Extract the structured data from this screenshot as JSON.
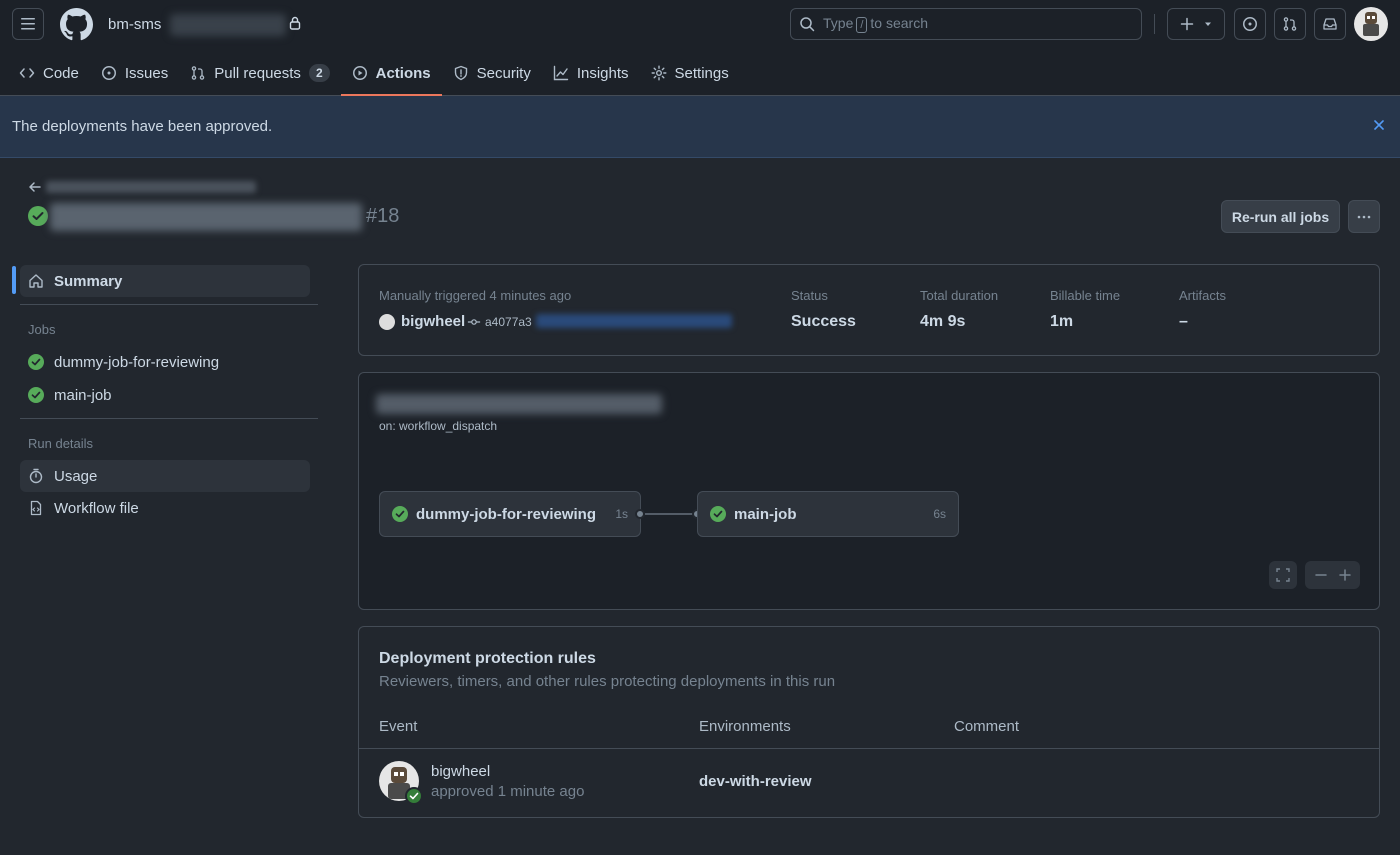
{
  "header": {
    "owner": "bm-sms",
    "search_text_before": "Type",
    "search_key": "/",
    "search_text_after": "to search"
  },
  "nav": {
    "tabs": [
      {
        "label": "Code",
        "icon": "code-icon"
      },
      {
        "label": "Issues",
        "icon": "issue-opened-icon"
      },
      {
        "label": "Pull requests",
        "icon": "git-pull-request-icon",
        "count": "2"
      },
      {
        "label": "Actions",
        "icon": "play-icon",
        "active": true
      },
      {
        "label": "Security",
        "icon": "shield-icon"
      },
      {
        "label": "Insights",
        "icon": "graph-icon"
      },
      {
        "label": "Settings",
        "icon": "gear-icon"
      }
    ]
  },
  "flash": {
    "message": "The deployments have been approved."
  },
  "run": {
    "number": "#18",
    "rerun_label": "Re-run all jobs"
  },
  "sidebar": {
    "summary": "Summary",
    "jobs_heading": "Jobs",
    "jobs": [
      "dummy-job-for-reviewing",
      "main-job"
    ],
    "details_heading": "Run details",
    "usage": "Usage",
    "workflow_file": "Workflow file"
  },
  "summary": {
    "trigger": "Manually triggered 4 minutes ago",
    "actor": "bigwheel",
    "commit": "a4077a3",
    "status_label": "Status",
    "status_value": "Success",
    "duration_label": "Total duration",
    "duration_value": "4m 9s",
    "billable_label": "Billable time",
    "billable_value": "1m",
    "artifacts_label": "Artifacts",
    "artifacts_value": "–"
  },
  "graph": {
    "trigger": "on: workflow_dispatch",
    "jobs": [
      {
        "name": "dummy-job-for-reviewing",
        "duration": "1s"
      },
      {
        "name": "main-job",
        "duration": "6s"
      }
    ]
  },
  "deployment_rules": {
    "title": "Deployment protection rules",
    "subtitle": "Reviewers, timers, and other rules protecting deployments in this run",
    "columns": [
      "Event",
      "Environments",
      "Comment"
    ],
    "rows": [
      {
        "user": "bigwheel",
        "action": "approved 1 minute ago",
        "environment": "dev-with-review",
        "comment": ""
      }
    ]
  },
  "colors": {
    "success": "#57ab5a",
    "accent": "#539bf5",
    "active_tab": "#ec775c"
  }
}
